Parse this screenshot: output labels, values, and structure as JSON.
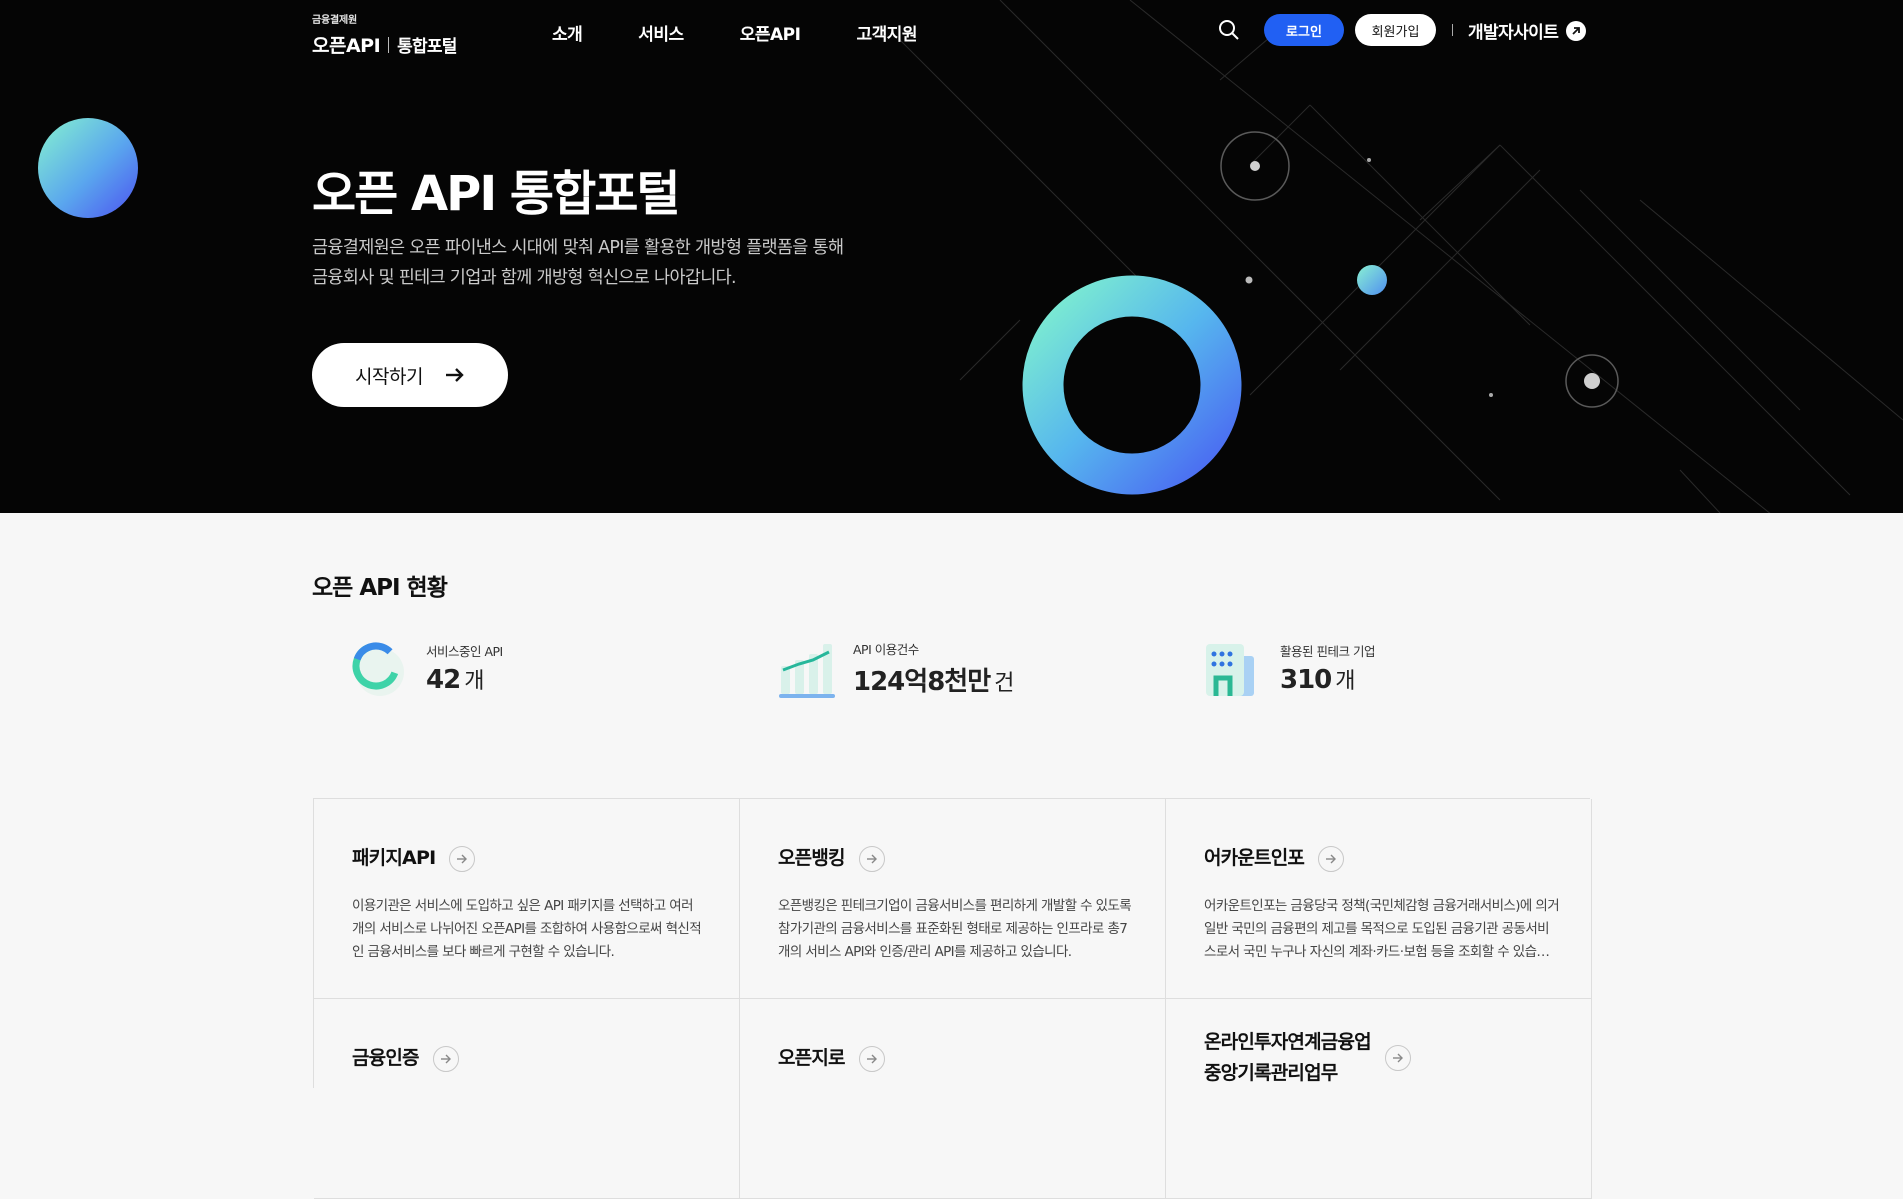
{
  "header": {
    "logo_sub": "금융결제원",
    "logo_api": "오픈API",
    "logo_portal": "통합포털",
    "nav": [
      "소개",
      "서비스",
      "오픈API",
      "고객지원"
    ],
    "login": "로그인",
    "join": "회원가입",
    "dev_site": "개발자사이트"
  },
  "hero": {
    "title": "오픈 API 통합포털",
    "desc_line1": "금융결제원은 오픈 파이낸스 시대에 맞춰 API를 활용한 개방형 플랫폼을 통해",
    "desc_line2": "금융회사 및 핀테크 기업과 함께 개방형 혁신으로 나아갑니다.",
    "start_label": "시작하기"
  },
  "stats": {
    "title": "오픈 API 현황",
    "items": [
      {
        "label": "서비스중인 API",
        "value": "42",
        "unit": "개"
      },
      {
        "label": "API 이용건수",
        "value": "124억8천만",
        "unit": "건"
      },
      {
        "label": "활용된 핀테크 기업",
        "value": "310",
        "unit": "개"
      }
    ]
  },
  "cards": [
    {
      "title": "패키지API",
      "desc": "이용기관은 서비스에 도입하고 싶은 API 패키지를 선택하고 여러 개의 서비스로 나뉘어진 오픈API를 조합하여 사용함으로써 혁신적인 금융서비스를 보다 빠르게 구현할 수 있습니다."
    },
    {
      "title": "오픈뱅킹",
      "desc": "오픈뱅킹은 핀테크기업이 금융서비스를 편리하게 개발할 수 있도록 참가기관의 금융서비스를 표준화된 형태로 제공하는 인프라로 총7개의 서비스 API와 인증/관리 API를 제공하고 있습니다."
    },
    {
      "title": "어카운트인포",
      "desc": "어카운트인포는 금융당국 정책(국민체감형 금융거래서비스)에 의거 일반 국민의 금융편의 제고를 목적으로 도입된 금융기관 공동서비스로서 국민 누구나 자신의 계좌·카드·보험 등을 조회할 수 있습니다."
    },
    {
      "title": "금융인증",
      "desc": ""
    },
    {
      "title": "오픈지로",
      "desc": ""
    },
    {
      "title": "온라인투자연계금융업\n중앙기록관리업무",
      "desc": ""
    }
  ],
  "icons": {
    "search": "search-icon",
    "dev_arrow": "external-arrow-icon",
    "start_arrow": "arrow-right-icon",
    "stat_icons": [
      "donut-chart-icon",
      "line-chart-icon",
      "building-icon"
    ],
    "card_arrow": "circle-arrow-right-icon"
  },
  "colors": {
    "brand_blue": "#2160f3",
    "hero_bg": "#050505",
    "accent_mint": "#7ff0cf",
    "accent_blue": "#4f63f0"
  }
}
